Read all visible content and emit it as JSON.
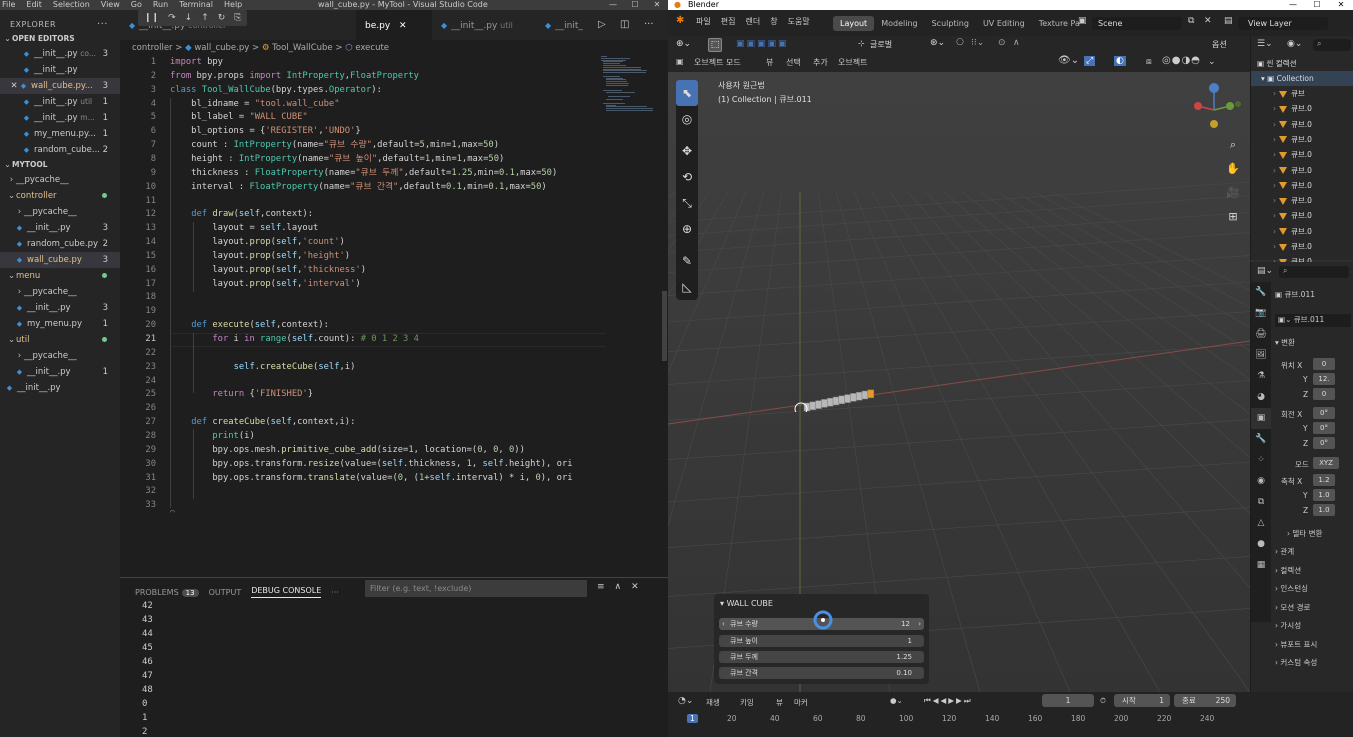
{
  "vscode": {
    "menu": [
      "File",
      "Edit",
      "Selection",
      "View",
      "Go",
      "Run",
      "Terminal",
      "Help"
    ],
    "title": "wall_cube.py - MyTool - Visual Studio Code",
    "window_buttons": [
      "—",
      "☐",
      "✕"
    ],
    "explorer_label": "EXPLORER",
    "open_editors_label": "OPEN EDITORS",
    "open_editors": [
      {
        "name": "__init__.py",
        "sub": "co...",
        "badge": "3"
      },
      {
        "name": "__init__.py",
        "sub": "",
        "badge": ""
      },
      {
        "name": "wall_cube.py...",
        "sub": "",
        "badge": "3"
      },
      {
        "name": "__init__.py",
        "sub": "util",
        "badge": "1"
      },
      {
        "name": "__init__.py",
        "sub": "m...",
        "badge": "1"
      },
      {
        "name": "my_menu.py...",
        "sub": "",
        "badge": "1"
      },
      {
        "name": "random_cube...",
        "sub": "",
        "badge": "2"
      }
    ],
    "folder_label": "MYTOOL",
    "tree": [
      {
        "name": "__pycache__",
        "kind": "folder",
        "badge": ""
      },
      {
        "name": "controller",
        "kind": "folder-open",
        "badge": ""
      },
      {
        "name": "__pycache__",
        "kind": "folder",
        "badge": ""
      },
      {
        "name": "__init__.py",
        "kind": "py",
        "badge": "3"
      },
      {
        "name": "random_cube.py",
        "kind": "py",
        "badge": "2"
      },
      {
        "name": "wall_cube.py",
        "kind": "py",
        "badge": "3"
      },
      {
        "name": "menu",
        "kind": "folder-open",
        "badge": ""
      },
      {
        "name": "__pycache__",
        "kind": "folder",
        "badge": ""
      },
      {
        "name": "__init__.py",
        "kind": "py",
        "badge": "3"
      },
      {
        "name": "my_menu.py",
        "kind": "py",
        "badge": "1"
      },
      {
        "name": "util",
        "kind": "folder-open",
        "badge": ""
      },
      {
        "name": "__pycache__",
        "kind": "folder",
        "badge": ""
      },
      {
        "name": "__init__.py",
        "kind": "py",
        "badge": "1"
      },
      {
        "name": "__init__.py",
        "kind": "py",
        "badge": ""
      }
    ],
    "tabs": [
      {
        "name": "__init__.py",
        "sub": "controller"
      },
      {
        "name": "be.py",
        "sub": ""
      },
      {
        "name": "__init__.py",
        "sub": "util"
      },
      {
        "name": "__init_",
        "sub": ""
      }
    ],
    "tab_tools": [
      "❙❙",
      "↷",
      "↓",
      "↑",
      "↻",
      "⎘",
      "□"
    ],
    "breadcrumb": [
      "controller",
      ">",
      "wall_cube.py",
      ">",
      "Tool_WallCube",
      ">",
      "execute"
    ],
    "line_numbers": [
      "1",
      "2",
      "3",
      "4",
      "5",
      "6",
      "7",
      "8",
      "9",
      "10",
      "11",
      "12",
      "13",
      "14",
      "15",
      "16",
      "17",
      "18",
      "19",
      "20",
      "21",
      "22",
      "23",
      "24",
      "25",
      "26",
      "27",
      "28",
      "29",
      "30",
      "31",
      "32",
      "33"
    ],
    "current_line": "21",
    "code_lines": [
      "import bpy",
      "from bpy.props import IntProperty,FloatProperty",
      "class Tool_WallCube(bpy.types.Operator):",
      "    bl_idname = \"tool.wall_cube\"",
      "    bl_label = \"WALL CUBE\"",
      "    bl_options = {'REGISTER','UNDO'}",
      "    count : IntProperty(name=\"큐브 수량\",default=5,min=1,max=50)",
      "    height : IntProperty(name=\"큐브 높이\",default=1,min=1,max=50)",
      "    thickness : FloatProperty(name=\"큐브 두께\",default=1.25,min=0.1,max=50)",
      "    interval : FloatProperty(name=\"큐브 간격\",default=0.1,min=0.1,max=50)",
      "",
      "    def draw(self,context):",
      "        layout = self.layout",
      "        layout.prop(self,'count')",
      "        layout.prop(self,'height')",
      "        layout.prop(self,'thickness')",
      "        layout.prop(self,'interval')",
      "",
      "",
      "    def execute(self,context):",
      "        for i in range(self.count): # 0 1 2 3 4",
      "",
      "            self.createCube(self,i)",
      "",
      "        return {'FINISHED'}",
      "",
      "    def createCube(self,context,i):",
      "        print(i)",
      "        bpy.ops.mesh.primitive_cube_add(size=1, location=(0, 0, 0))",
      "        bpy.ops.transform.resize(value=(self.thickness, 1, self.height), ori",
      "        bpy.ops.transform.translate(value=(0, (1+self.interval) * i, 0), ori",
      "",
      ""
    ],
    "panel": {
      "tabs": [
        "PROBLEMS",
        "OUTPUT",
        "DEBUG CONSOLE",
        "···"
      ],
      "problems_badge": "13",
      "filter_placeholder": "Filter (e.g. text, !exclude)",
      "tools": [
        "≡",
        "∧",
        "✕"
      ],
      "console_lines": [
        "42",
        "43",
        "44",
        "45",
        "46",
        "47",
        "48",
        "0",
        "1",
        "2"
      ]
    }
  },
  "blender": {
    "title": "Blender",
    "window_buttons": [
      "—",
      "☐",
      "✕"
    ],
    "menu": [
      "파일",
      "편집",
      "렌더",
      "창",
      "도움말"
    ],
    "workspaces": [
      "Layout",
      "Modeling",
      "Sculpting",
      "UV Editing",
      "Texture Pa"
    ],
    "active_workspace": "Layout",
    "scene": "Scene",
    "view_layer": "View Layer",
    "transform_orientation": "글로벌",
    "options_label": "옵션",
    "mode": "오브젝트 모드",
    "header_menu": [
      "뷰",
      "선택",
      "추가",
      "오브젝트"
    ],
    "view_name": "사용자 원근법",
    "view_collection": "(1) Collection | 큐브.011",
    "operator_panel": {
      "title": "WALL CUBE",
      "rows": [
        {
          "label": "큐브 수량",
          "value": "12"
        },
        {
          "label": "큐브 높이",
          "value": "1"
        },
        {
          "label": "큐브 두께",
          "value": "1.25"
        },
        {
          "label": "큐브 간격",
          "value": "0.10"
        }
      ]
    },
    "outliner": {
      "root": "씬 컬렉션",
      "collection": "Collection",
      "items": [
        "큐브",
        "큐브.0",
        "큐브.0",
        "큐브.0",
        "큐브.0",
        "큐브.0",
        "큐브.0",
        "큐브.0",
        "큐브.0",
        "큐브.0",
        "큐브.0",
        "큐브.0"
      ]
    },
    "properties": {
      "object_name": "큐브.011",
      "data_name": "큐브.011",
      "section_transform": "변환",
      "location_label": "위치 X",
      "location": [
        "0",
        "12.",
        "0"
      ],
      "rotation_label": "회전 X",
      "rotation": [
        "0°",
        "0°",
        "0°"
      ],
      "mode_label": "모드",
      "mode_value": "XYZ",
      "scale_label": "축척 X",
      "scale": [
        "1.2",
        "1.0",
        "1.0"
      ],
      "axis_y": "Y",
      "axis_z": "Z",
      "delta": "델타 변환",
      "sections": [
        "관계",
        "컬렉션",
        "인스턴싱",
        "모션 경로",
        "가시성",
        "뷰포트 표시",
        "커스텀 속성"
      ]
    },
    "timeline": {
      "menu": [
        "재생",
        "키잉",
        "뷰",
        "마커"
      ],
      "current_frame": "1",
      "start_label": "시작",
      "start": "1",
      "end_label": "종료",
      "end": "250",
      "ruler": [
        "1",
        "20",
        "40",
        "60",
        "80",
        "100",
        "120",
        "140",
        "160",
        "180",
        "200",
        "220",
        "240"
      ]
    },
    "colors": {
      "accent": "#4772b3",
      "object_orange": "#e39a2d"
    }
  }
}
